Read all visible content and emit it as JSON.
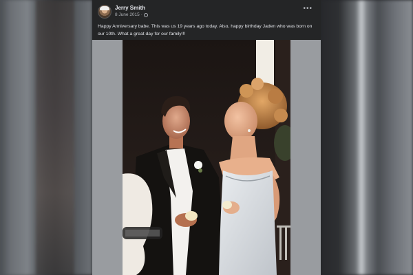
{
  "post": {
    "author": "Jerry Smith",
    "date": "8 June 2015",
    "separator": "·",
    "more_icon": "more-options-icon",
    "text": "Happy Anniversary babe. This was us 19 years ago today.  Also, happy birthday Jaden who was born on our 10th. What a great day for our family!!!"
  },
  "colors": {
    "card_bg": "#242526",
    "text_primary": "#e4e6eb",
    "text_secondary": "#b0b3b8"
  }
}
